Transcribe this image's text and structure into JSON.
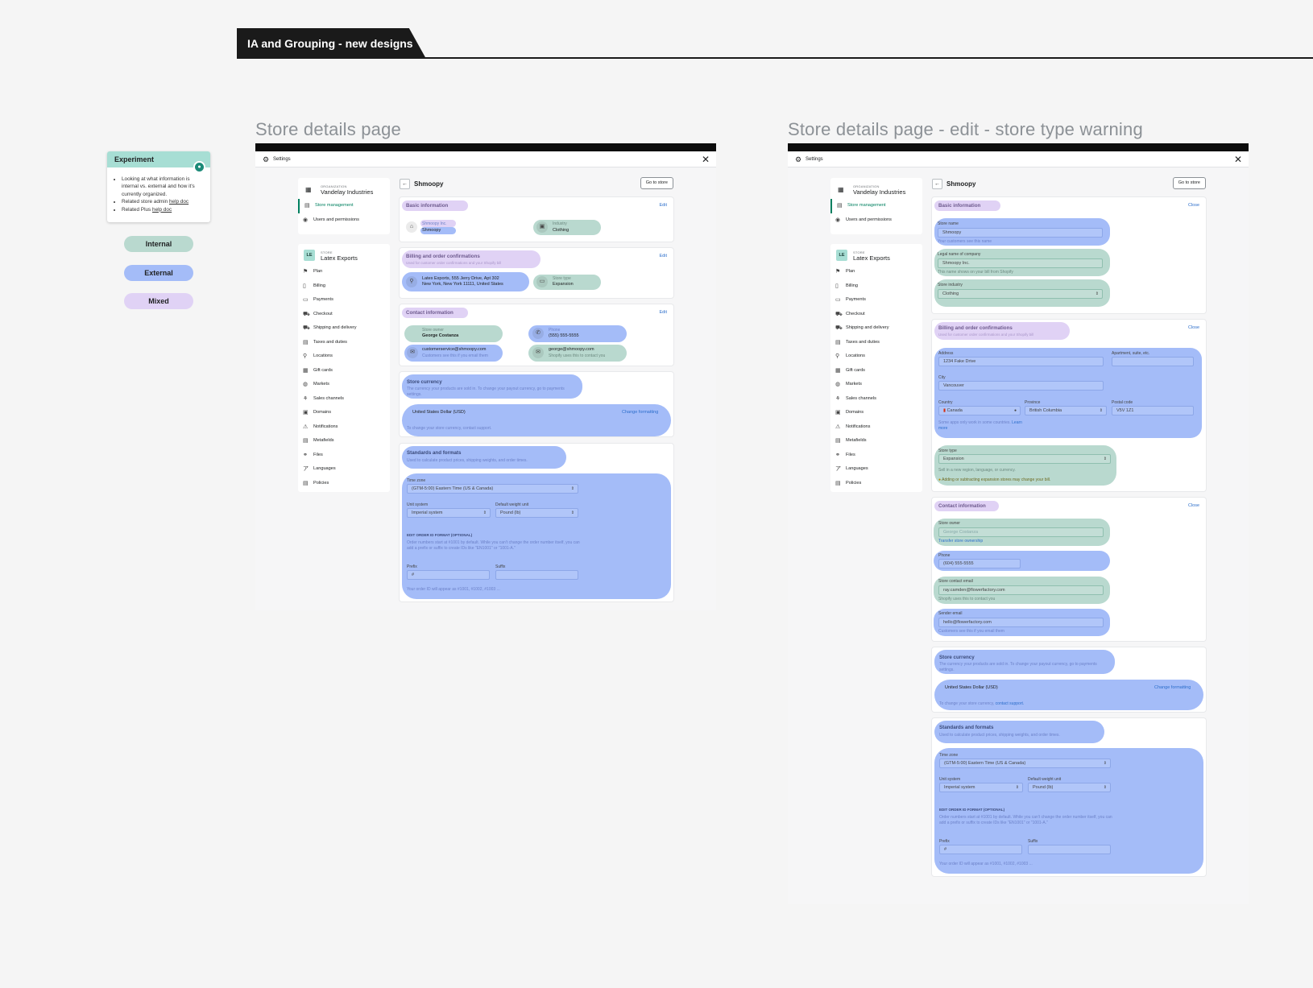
{
  "header": {
    "title": "IA and Grouping - new designs"
  },
  "pages": {
    "left_title": "Store details page",
    "right_title": "Store details page - edit - store type warning"
  },
  "experiment": {
    "title": "Experiment",
    "b1": "Looking at what information is internal vs. external and how it's currently organized.",
    "b2a": "Related store admin ",
    "b2b": "help doc",
    "b3a": "Related Plus ",
    "b3b": "help doc"
  },
  "legend": {
    "internal": "Internal",
    "external": "External",
    "mixed": "Mixed"
  },
  "settings": {
    "title": "Settings"
  },
  "sidebar": {
    "org_label": "ORGANIZATION",
    "org_name": "Vandelay Industries",
    "store_mgmt": "Store management",
    "users": "Users and permissions",
    "store_label": "STORE",
    "store_name": "Latex Exports",
    "store_initials": "LE",
    "items": [
      "Plan",
      "Billing",
      "Payments",
      "Checkout",
      "Shipping and delivery",
      "Taxes and duties",
      "Locations",
      "Gift cards",
      "Markets",
      "Sales channels",
      "Domains",
      "Notifications",
      "Metafields",
      "Files",
      "Languages",
      "Policies"
    ]
  },
  "main": {
    "title": "Shmoopy",
    "go_to_store": "Go to store",
    "edit": "Edit",
    "close": "Close",
    "basic": "Basic information",
    "legal_name": "Shmoopy Inc.",
    "store_name": "Shmoopy",
    "industry_label": "Industry",
    "industry": "Clothing",
    "billing": "Billing and order confirmations",
    "billing_sub": "Used for customer order confirmations and your Shopify bill",
    "address_line1": "Latex Exports, 555 Jerry Drive, Apt 302",
    "address_line2": "New York, New York 11111, United States",
    "store_type_label": "Store type",
    "store_type": "Expansion",
    "contact": "Contact information",
    "owner_label": "Store owner",
    "owner": "George Costanza",
    "phone_label": "Phone",
    "phone": "(555) 555-5555",
    "cs_email": "customerservice@shmoopy.com",
    "cs_sub": "Customers see this if you email them",
    "g_email": "george@shmoopy.com",
    "g_sub": "Shopify uses this to contact you",
    "currency": "Store currency",
    "currency_sub": "The currency your products are sold in. To change your payout currency, go to payments settings.",
    "usd": "United States Dollar (USD)",
    "change_fmt": "Change formatting",
    "change_cur_a": "To change your store currency, ",
    "change_cur_b": "contact support.",
    "standards": "Standards and formats",
    "standards_sub": "Used to calculate product prices, shipping weights, and order times.",
    "tz_label": "Time zone",
    "tz": "(GTM-5:00) Eastern Time (US & Canada)",
    "unit_label": "Unit system",
    "unit": "Imperial system",
    "weight_label": "Default weight unit",
    "weight": "Pound (lb)",
    "order_fmt": "EDIT ORDER ID FORMAT (OPTIONAL)",
    "order_sub": "Order numbers start at #1001 by default. While you can't change the order number itself, you can add a prefix or suffix to create IDs like \"EN1001\" or \"1001-A.\"",
    "prefix": "Prefix",
    "suffix": "Suffix",
    "prefix_val": "#",
    "order_appear": "Your order ID will appear as #1001, #1002, #1003 ..."
  },
  "edit": {
    "store_name_label": "Store name",
    "store_name": "Shmoopy",
    "store_name_sub": "Your customers see this name",
    "legal_label": "Legal name of company",
    "legal": "Shmoopy Inc.",
    "legal_sub": "This name shows on your bill from Shopify",
    "industry_label": "Store industry",
    "industry": "Clothing",
    "address_label": "Address",
    "address": "1234 Fake Drive",
    "apt_label": "Apartment, suite, etc.",
    "city_label": "City",
    "city": "Vancouver",
    "country_label": "Country",
    "country": "Canada",
    "province_label": "Province",
    "province": "British Columbia",
    "postal_label": "Postal code",
    "postal": "V5V 1Z1",
    "country_sub_a": "Some apps only work in some countries. ",
    "country_sub_b": "Learn more",
    "type_label": "Store type",
    "type": "Expansion",
    "type_sub": "Sell in a new region, language, or currency.",
    "type_warn": "Adding or subtracting expansion stores may change your bill.",
    "owner_label": "Store owner",
    "owner": "George Costanza",
    "transfer": "Transfer store ownership",
    "phone_label": "Phone",
    "phone": "(604) 555-5555",
    "contact_label": "Store contact email",
    "contact_email": "ray.camden@flowerfactory.com",
    "contact_sub": "Shopify uses this to contact you",
    "sender_label": "Sender email",
    "sender": "hello@flowerfactory.com",
    "sender_sub": "Customers see this if you email them"
  },
  "colors": {
    "internal": "#b9d9cf",
    "external": "#a4bcf8",
    "mixed": "#e0d2f5",
    "accent": "#008060"
  }
}
